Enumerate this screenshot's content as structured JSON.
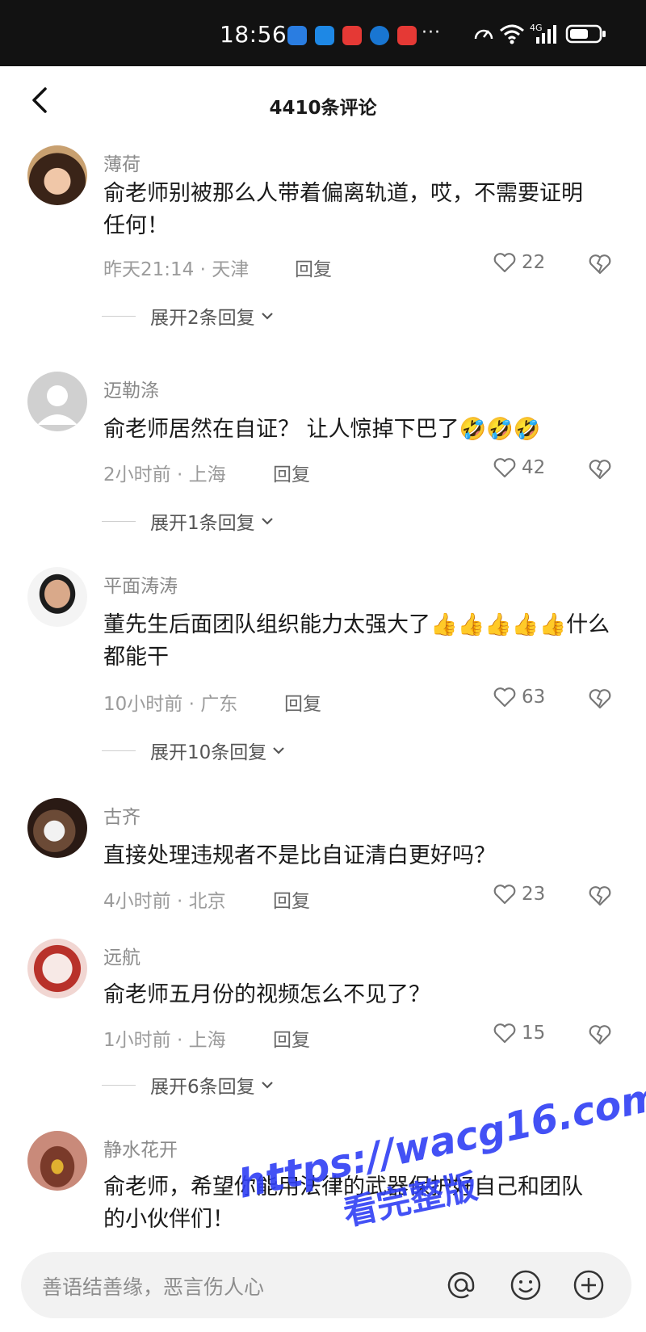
{
  "status_bar": {
    "time": "18:56",
    "more": "···",
    "network": "4G"
  },
  "header": {
    "title": "4410条评论"
  },
  "comments": [
    {
      "user": "薄荷",
      "text": "俞老师别被那么人带着偏离轨道，哎，不需要证明任何！",
      "time": "昨天21:14 · 天津",
      "reply": "回复",
      "likes": "22",
      "expand": "展开2条回复"
    },
    {
      "user": "迈勒涤",
      "text": "俞老师居然在自证？ 让人惊掉下巴了🤣🤣🤣",
      "time": "2小时前 · 上海",
      "reply": "回复",
      "likes": "42",
      "expand": "展开1条回复"
    },
    {
      "user": "平面涛涛",
      "text": "董先生后面团队组织能力太强大了👍👍👍👍👍什么都能干",
      "time": "10小时前 · 广东",
      "reply": "回复",
      "likes": "63",
      "expand": "展开10条回复"
    },
    {
      "user": "古齐",
      "text": "直接处理违规者不是比自证清白更好吗？",
      "time": "4小时前 · 北京",
      "reply": "回复",
      "likes": "23",
      "expand": ""
    },
    {
      "user": "远航",
      "text": "俞老师五月份的视频怎么不见了？",
      "time": "1小时前 · 上海",
      "reply": "回复",
      "likes": "15",
      "expand": "展开6条回复"
    },
    {
      "user": "静水花开",
      "text": "俞老师，希望你能用法律的武器保护好自己和团队的小伙伴们！",
      "time": "",
      "reply": "",
      "likes": "",
      "expand": ""
    }
  ],
  "input": {
    "placeholder": "善语结善缘，恶言伤人心"
  },
  "watermark": {
    "line1": "https://wacg16.com",
    "line2": "看完整版"
  },
  "colors": {
    "statusbar": "#121212",
    "watermark": "#2f3ff5"
  }
}
